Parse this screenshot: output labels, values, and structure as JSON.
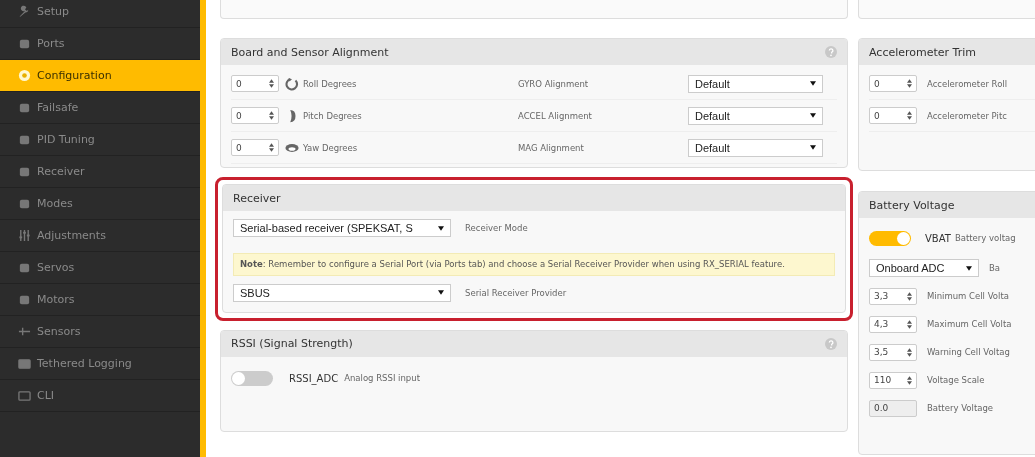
{
  "sidebar": {
    "items": [
      {
        "label": "Setup",
        "selected": false
      },
      {
        "label": "Ports",
        "selected": false
      },
      {
        "label": "Configuration",
        "selected": true
      },
      {
        "label": "Failsafe",
        "selected": false
      },
      {
        "label": "PID Tuning",
        "selected": false
      },
      {
        "label": "Receiver",
        "selected": false
      },
      {
        "label": "Modes",
        "selected": false
      },
      {
        "label": "Adjustments",
        "selected": false
      },
      {
        "label": "Servos",
        "selected": false
      },
      {
        "label": "Motors",
        "selected": false
      },
      {
        "label": "Sensors",
        "selected": false
      },
      {
        "label": "Tethered Logging",
        "selected": false
      },
      {
        "label": "CLI",
        "selected": false
      }
    ]
  },
  "board_alignment": {
    "title": "Board and Sensor Alignment",
    "rows": [
      {
        "value": "0",
        "label": "Roll Degrees",
        "sensor_label": "GYRO Alignment",
        "select": "Default"
      },
      {
        "value": "0",
        "label": "Pitch Degrees",
        "sensor_label": "ACCEL Alignment",
        "select": "Default"
      },
      {
        "value": "0",
        "label": "Yaw Degrees",
        "sensor_label": "MAG Alignment",
        "select": "Default"
      }
    ]
  },
  "receiver": {
    "title": "Receiver",
    "mode_select": "Serial-based receiver (SPEKSAT, S",
    "mode_label": "Receiver Mode",
    "note": "**Note**: Remember to configure a Serial Port (via Ports tab) and choose a Serial Receiver Provider when using RX_SERIAL feature.",
    "provider_select": "SBUS",
    "provider_label": "Serial Receiver Provider"
  },
  "rssi": {
    "title": "RSSI (Signal Strength)",
    "on": false,
    "name": "RSSI_ADC",
    "description": "Analog RSSI input"
  },
  "accelerometer_trim": {
    "title": "Accelerometer Trim",
    "rows": [
      {
        "value": "0",
        "label": "Accelerometer Roll"
      },
      {
        "value": "0",
        "label": "Accelerometer Pitc"
      }
    ]
  },
  "battery_voltage": {
    "title": "Battery Voltage",
    "on": true,
    "name": "VBAT",
    "description": "Battery voltag",
    "meter_select": "Onboard ADC",
    "meter_label": "Ba",
    "rows": [
      {
        "kind": "spinner",
        "value": "3,3",
        "label": "Minimum Cell Volta"
      },
      {
        "kind": "spinner",
        "value": "4,3",
        "label": "Maximum Cell Volta"
      },
      {
        "kind": "spinner",
        "value": "3,5",
        "label": "Warning Cell Voltag"
      },
      {
        "kind": "spinner",
        "value": "110",
        "label": "Voltage Scale"
      },
      {
        "kind": "readonly",
        "value": "0.0",
        "label": "Battery Voltage"
      }
    ]
  }
}
